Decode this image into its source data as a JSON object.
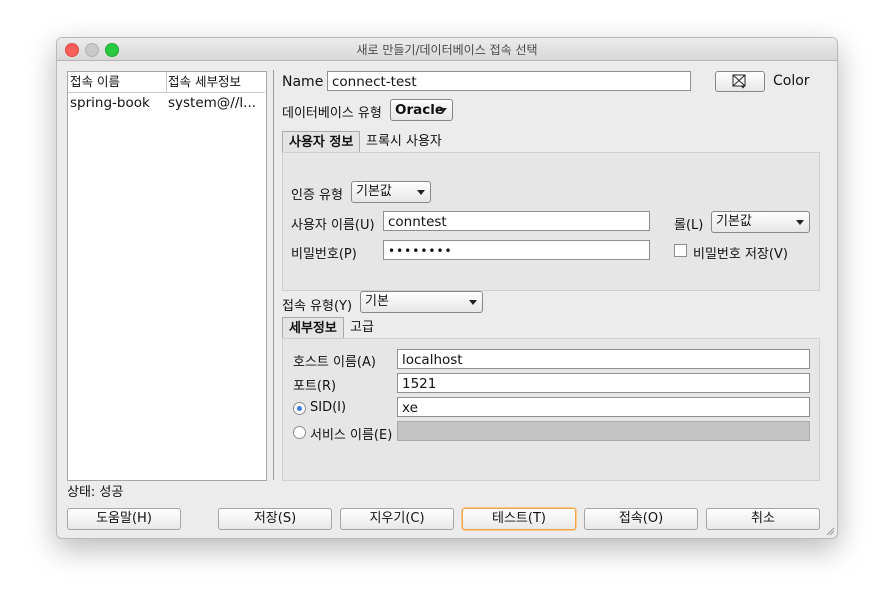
{
  "window": {
    "title": "새로 만들기/데이터베이스 접속 선택",
    "traffic_colors": {
      "close": "#fc5f57",
      "minimize": "#c5c5c5",
      "maximize": "#2ac940"
    }
  },
  "connections": {
    "headers": [
      "접속 이름",
      "접속 세부정보"
    ],
    "rows": [
      {
        "name": "spring-book",
        "details": "system@//l..."
      }
    ]
  },
  "status": {
    "label": "상태: 성공"
  },
  "form": {
    "name_label": "Name",
    "name_value": "connect-test",
    "color_label": "Color",
    "db_type_label": "데이터베이스 유형",
    "db_type_value": "Oracle",
    "user_tabs": [
      "사용자 정보",
      "프록시 사용자"
    ],
    "auth_type_label": "인증 유형",
    "auth_type_value": "기본값",
    "username_label": "사용자 이름(U)",
    "username_value": "conntest",
    "role_label": "롤(L)",
    "role_value": "기본값",
    "password_label": "비밀번호(P)",
    "password_value": "••••••••",
    "save_password_label": "비밀번호 저장(V)",
    "save_password_checked": false,
    "conn_type_label": "접속 유형(Y)",
    "conn_type_value": "기본",
    "detail_tabs": [
      "세부정보",
      "고급"
    ],
    "host_label": "호스트 이름(A)",
    "host_value": "localhost",
    "port_label": "포트(R)",
    "port_value": "1521",
    "sid_label": "SID(I)",
    "sid_value": "xe",
    "sid_selected": true,
    "service_label": "서비스 이름(E)",
    "service_value": ""
  },
  "buttons": {
    "help": "도움말(H)",
    "save": "저장(S)",
    "clear": "지우기(C)",
    "test": "테스트(T)",
    "connect": "접속(O)",
    "cancel": "취소"
  }
}
